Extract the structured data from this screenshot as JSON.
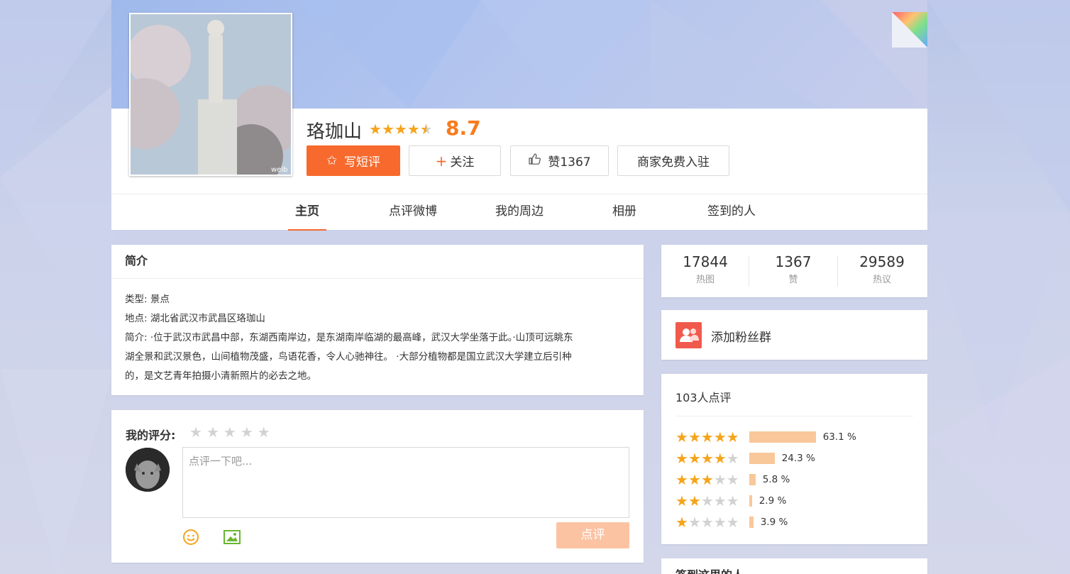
{
  "place": {
    "name": "珞珈山",
    "score": "8.7",
    "rating_stars": 4.5,
    "photo_watermark": "weib"
  },
  "actions": {
    "review_label": "写短评",
    "follow_label": "关注",
    "like_label": "赞1367",
    "merchant_label": "商家免费入驻"
  },
  "nav": {
    "tabs": [
      {
        "label": "主页",
        "active": true
      },
      {
        "label": "点评微博",
        "active": false
      },
      {
        "label": "我的周边",
        "active": false
      },
      {
        "label": "相册",
        "active": false
      },
      {
        "label": "签到的人",
        "active": false
      }
    ]
  },
  "intro": {
    "title": "简介",
    "type_line": "类型: 景点",
    "location_line": "地点: 湖北省武汉市武昌区珞珈山",
    "desc_line1": "简介: ·位于武汉市武昌中部，东湖西南岸边，是东湖南岸临湖的最高峰，武汉大学坐落于此。·山顶可远眺东",
    "desc_line2": "湖全景和武汉景色，山间植物茂盛，鸟语花香，令人心驰神往。 ·大部分植物都是国立武汉大学建立后引种",
    "desc_line3": "的，是文艺青年拍摄小清新照片的必去之地。"
  },
  "my_rating": {
    "label": "我的评分:",
    "stars": 0,
    "placeholder": "点评一下吧...",
    "submit_label": "点评"
  },
  "stats": [
    {
      "num": "17844",
      "label": "热图"
    },
    {
      "num": "1367",
      "label": "赞"
    },
    {
      "num": "29589",
      "label": "热议"
    }
  ],
  "fans": {
    "label": "添加粉丝群"
  },
  "ratings": {
    "title": "103人点评",
    "rows": [
      {
        "stars": 5,
        "percent": 63.1,
        "pct_label": "63.1 %"
      },
      {
        "stars": 4,
        "percent": 24.3,
        "pct_label": "24.3 %"
      },
      {
        "stars": 3,
        "percent": 5.8,
        "pct_label": "5.8 %"
      },
      {
        "stars": 2,
        "percent": 2.9,
        "pct_label": "2.9 %"
      },
      {
        "stars": 1,
        "percent": 3.9,
        "pct_label": "3.9 %"
      }
    ]
  },
  "checkin": {
    "title": "签到这里的人"
  },
  "colors": {
    "accent": "#f7692c",
    "score": "#f77c1e",
    "star_on": "#f5a41b",
    "star_off": "#d2d2d2",
    "bar": "#f8c89a"
  }
}
